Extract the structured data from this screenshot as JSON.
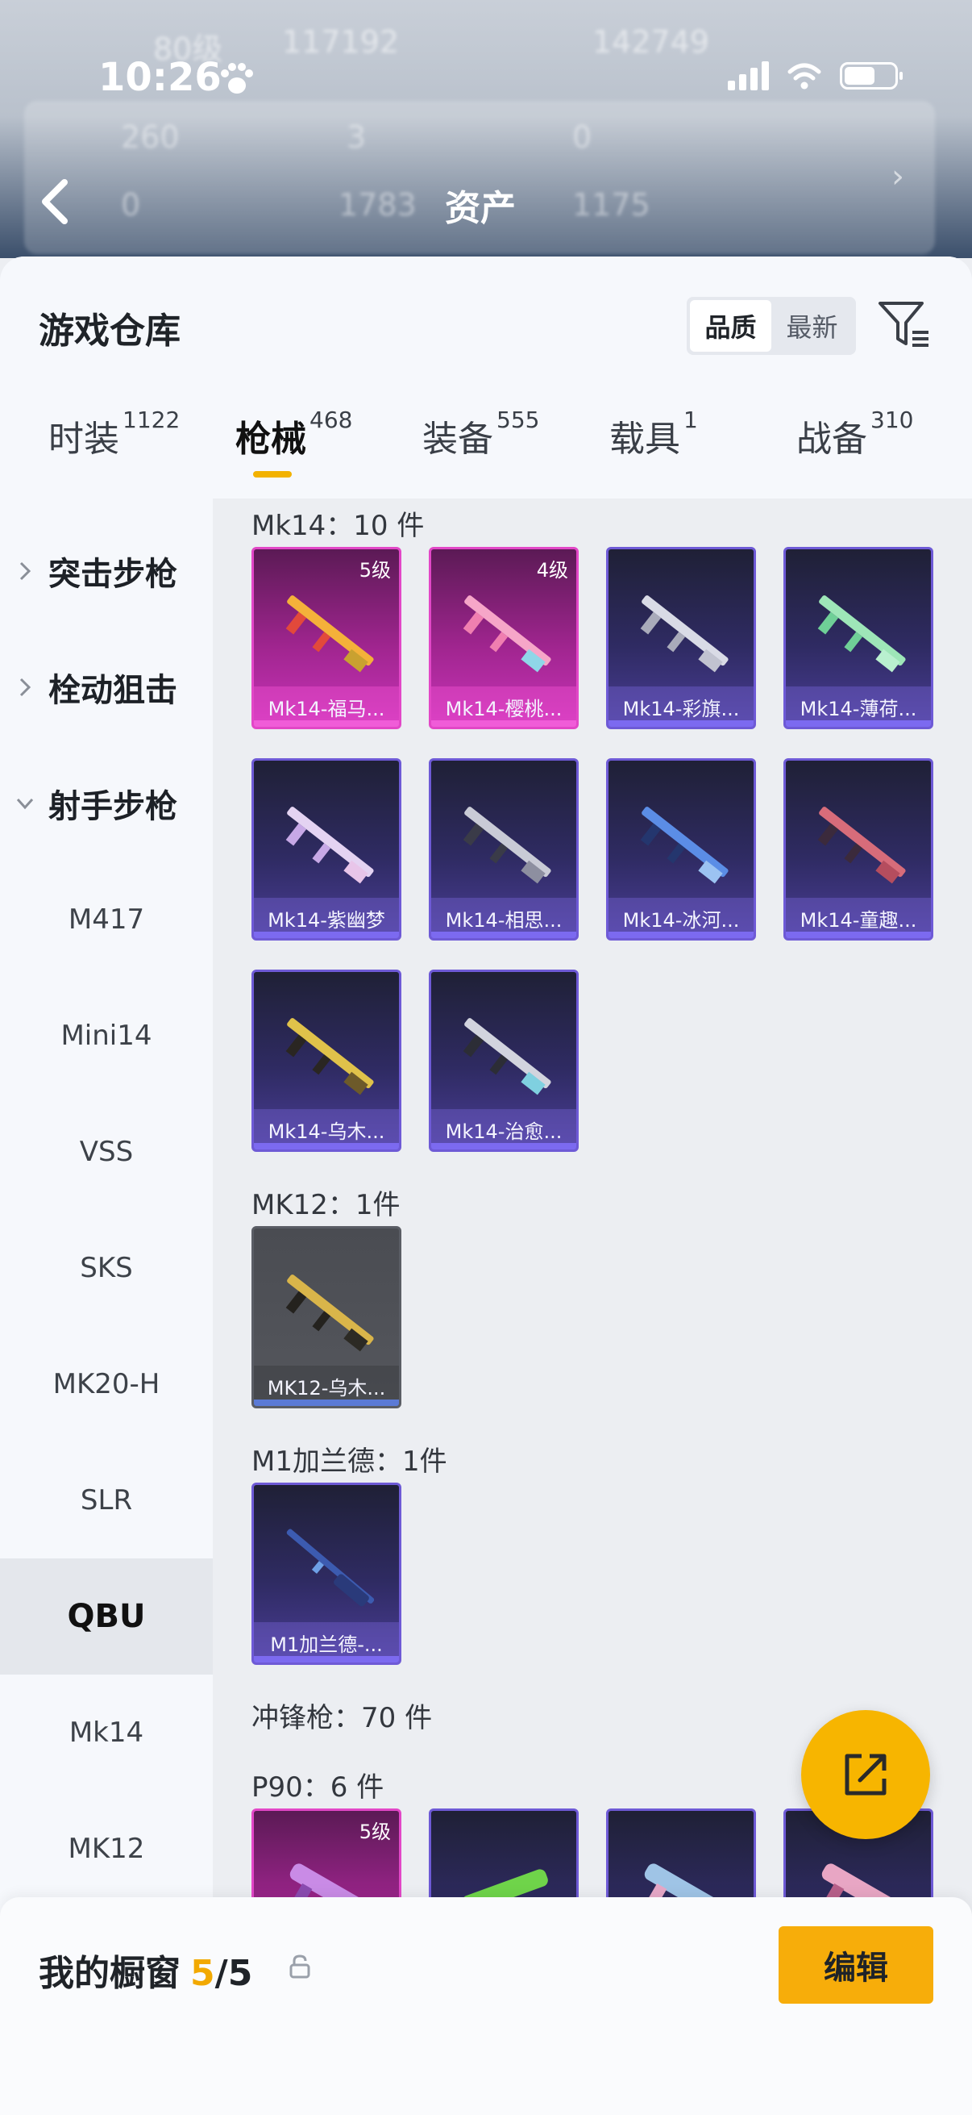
{
  "status_bar": {
    "time": "10:26"
  },
  "background_header": {
    "title": "资产",
    "blurred_texts": [
      "80级",
      "117192",
      "142749",
      "260",
      "3",
      "0",
      "0",
      "1783",
      "1175"
    ]
  },
  "warehouse": {
    "title": "游戏仓库",
    "sort_options": [
      "品质",
      "最新"
    ],
    "sort_selected": "品质",
    "tabs": [
      {
        "label": "时装",
        "count": "1122"
      },
      {
        "label": "枪械",
        "count": "468",
        "active": true
      },
      {
        "label": "装备",
        "count": "555"
      },
      {
        "label": "载具",
        "count": "1"
      },
      {
        "label": "战备",
        "count": "310"
      }
    ]
  },
  "sidebar": {
    "groups": [
      "突击步枪",
      "栓动狙击",
      "射手步枪"
    ],
    "items": [
      "M417",
      "Mini14",
      "VSS",
      "SKS",
      "MK20-H",
      "SLR",
      "QBU",
      "Mk14",
      "MK12"
    ],
    "selected": "QBU"
  },
  "content": {
    "sections": [
      {
        "title": "Mk14：10 件",
        "items": [
          {
            "name": "Mk14-福马...",
            "level": "5级",
            "rarity": "pink"
          },
          {
            "name": "Mk14-樱桃...",
            "level": "4级",
            "rarity": "pink"
          },
          {
            "name": "Mk14-彩旗...",
            "rarity": "purple"
          },
          {
            "name": "Mk14-薄荷...",
            "rarity": "purple"
          },
          {
            "name": "Mk14-紫幽梦",
            "rarity": "purple"
          },
          {
            "name": "Mk14-相思...",
            "rarity": "purple"
          },
          {
            "name": "Mk14-冰河...",
            "rarity": "purple"
          },
          {
            "name": "Mk14-童趣...",
            "rarity": "purple"
          },
          {
            "name": "Mk14-乌木...",
            "rarity": "purple"
          },
          {
            "name": "Mk14-治愈...",
            "rarity": "purple"
          }
        ]
      },
      {
        "title": "MK12：1件",
        "items": [
          {
            "name": "MK12-乌木...",
            "rarity": "grey"
          }
        ]
      },
      {
        "title": "M1加兰德：1件",
        "items": [
          {
            "name": "M1加兰德-...",
            "rarity": "purple"
          }
        ]
      },
      {
        "title": "冲锋枪：70 件"
      },
      {
        "title": "P90：6 件",
        "items": [
          {
            "level": "5级",
            "rarity": "pink"
          },
          {
            "rarity": "purple"
          },
          {
            "rarity": "purple"
          },
          {
            "rarity": "purple"
          }
        ]
      }
    ]
  },
  "showcase": {
    "label": "我的橱窗",
    "used": "5",
    "separator": "/",
    "total": "5",
    "edit_label": "编辑"
  },
  "colors": {
    "accent": "#f7b500",
    "pink_rarity": "#e247c7",
    "purple_rarity": "#6e5ad6"
  },
  "icons": [
    "paw-icon",
    "signal-icon",
    "wifi-icon",
    "battery-icon",
    "back-arrow-icon",
    "filter-icon",
    "chevron-icon",
    "gun-icon",
    "share-icon",
    "lock-icon"
  ]
}
